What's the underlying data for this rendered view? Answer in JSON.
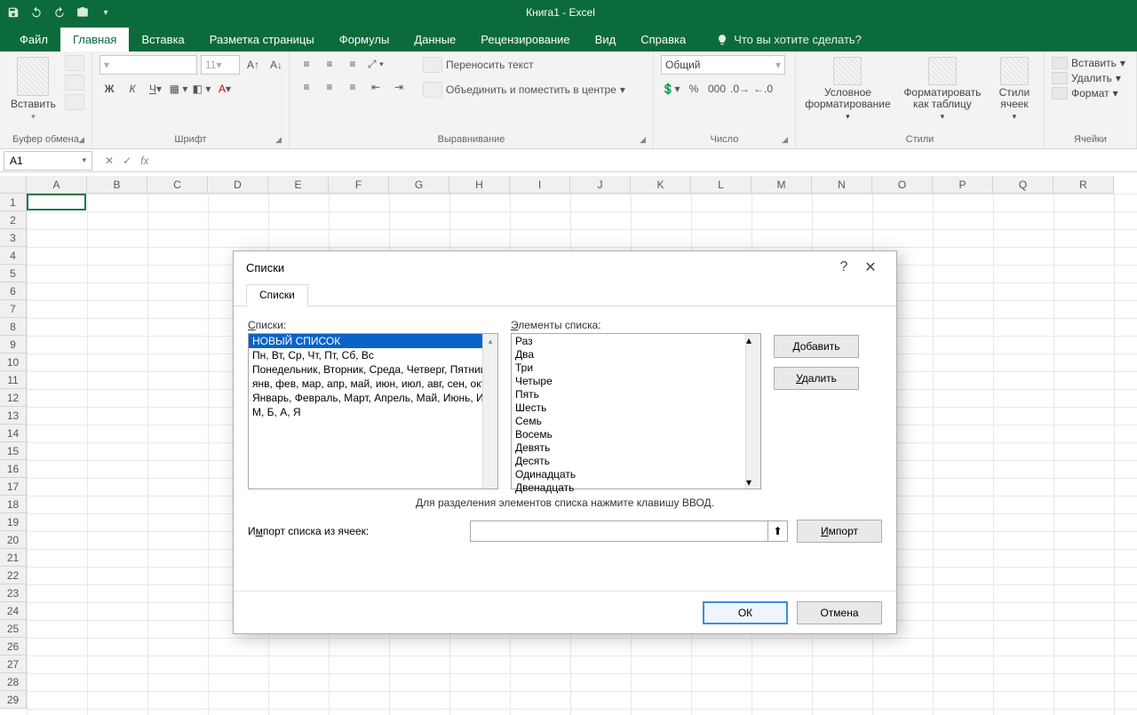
{
  "title": "Книга1  -  Excel",
  "tabs": [
    "Файл",
    "Главная",
    "Вставка",
    "Разметка страницы",
    "Формулы",
    "Данные",
    "Рецензирование",
    "Вид",
    "Справка"
  ],
  "tell_me": "Что вы хотите сделать?",
  "groups": {
    "clipboard": {
      "paste": "Вставить",
      "label": "Буфер обмена"
    },
    "font": {
      "size": "11",
      "label": "Шрифт"
    },
    "alignment": {
      "wrap": "Переносить текст",
      "merge": "Объединить и поместить в центре",
      "label": "Выравнивание"
    },
    "number": {
      "format": "Общий",
      "label": "Число"
    },
    "styles": {
      "cond": "Условное форматирование",
      "table": "Форматировать как таблицу",
      "cell": "Стили ячеек",
      "label": "Стили"
    },
    "cells": {
      "insert": "Вставить",
      "delete": "Удалить",
      "format": "Формат",
      "label": "Ячейки"
    }
  },
  "namebox": "A1",
  "columns": [
    "A",
    "B",
    "C",
    "D",
    "E",
    "F",
    "G",
    "H",
    "I",
    "J",
    "K",
    "L",
    "M",
    "N",
    "O",
    "P",
    "Q",
    "R"
  ],
  "dialog": {
    "title": "Списки",
    "tab": "Списки",
    "lists_label": "Списки:",
    "elements_label": "Элементы списка:",
    "lists": [
      "НОВЫЙ СПИСОК",
      "Пн, Вт, Ср, Чт, Пт, Сб, Вс",
      "Понедельник, Вторник, Среда, Четверг, Пятница, Су",
      "янв, фев, мар, апр, май, июн, июл, авг, сен, окт, но",
      "Январь, Февраль, Март, Апрель, Май, Июнь, Июль,",
      "М, Б, А, Я"
    ],
    "elements": [
      "Раз",
      "Два",
      "Три",
      "Четыре",
      "Пять",
      "Шесть",
      "Семь",
      "Восемь",
      "Девять",
      "Десять",
      "Одинадцать",
      "Двенадцать"
    ],
    "add": "Добавить",
    "delete": "Удалить",
    "hint": "Для разделения элементов списка нажмите клавишу ВВОД.",
    "import_label": "Импорт списка из ячеек:",
    "import": "Импорт",
    "ok": "ОК",
    "cancel": "Отмена"
  }
}
